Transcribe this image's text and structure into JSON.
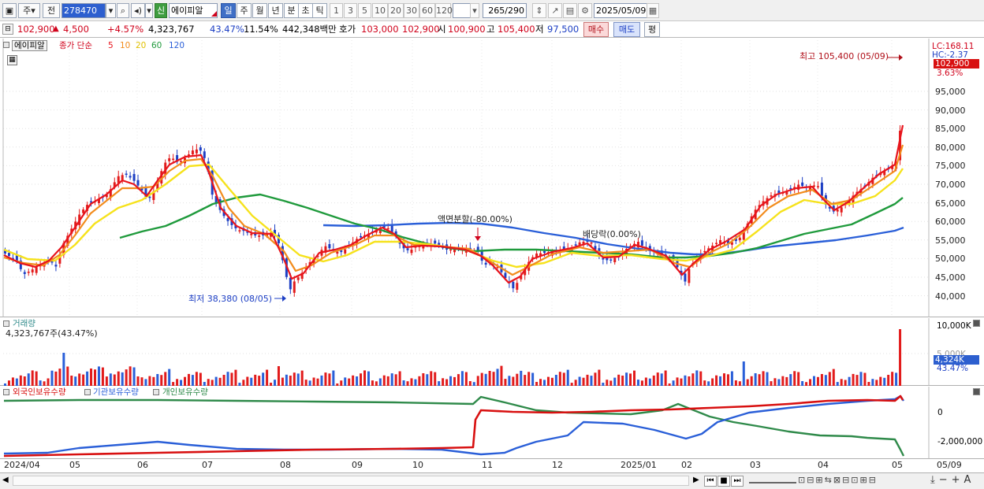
{
  "toolbar": {
    "period_types": [
      "주",
      "전"
    ],
    "code": "278470",
    "badge": "신",
    "stock_name": "에이피알",
    "periods": [
      "일",
      "주",
      "월",
      "년",
      "분",
      "초",
      "틱"
    ],
    "minutes": [
      "1",
      "3",
      "5",
      "10",
      "20",
      "30",
      "60",
      "120"
    ],
    "count": "265",
    "count_total": "/290",
    "date": "2025/05/09"
  },
  "quote": {
    "price": "102,900",
    "change": "4,500",
    "change_pct": "+4.57%",
    "volume": "4,323,767",
    "vol_ratio": "43.47%",
    "turnover": "11.54%",
    "amount": "442,348백만",
    "ask_label": "호가",
    "ask1": "103,000",
    "bid1": "102,900",
    "open_label": "시",
    "open": "100,900",
    "high_label": "고",
    "high": "105,400",
    "low_label": "저",
    "low": "97,500",
    "buy_label": "매수",
    "sell_label": "매도",
    "eval_label": "평"
  },
  "price_panel": {
    "legend_name": "에이피알",
    "legend_ma": "종가 단순",
    "ma_periods": [
      "5",
      "10",
      "20",
      "60",
      "120"
    ],
    "ma_colors": [
      "#e8141c",
      "#f28c1c",
      "#f6e21c",
      "#1f9a3c",
      "#2a5fd8"
    ],
    "lc": "LC:168.11",
    "hc": "HC:-2.37",
    "last_price": "102,900",
    "last_pct": "3.63%",
    "high_note": "최고 105,400 (05/09)",
    "low_note": "최저 38,380 (08/05)",
    "split_note": "액면분할(-80.00%)",
    "dividend_note": "배당락(0.00%)",
    "y_ticks": [
      "95,000",
      "90,000",
      "85,000",
      "80,000",
      "75,000",
      "70,000",
      "65,000",
      "60,000",
      "55,000",
      "50,000",
      "45,000",
      "40,000"
    ]
  },
  "volume_panel": {
    "title": "거래량",
    "value": "4,323,767주(43.47%)",
    "y_ticks": [
      "10,000K",
      "5,000K"
    ],
    "last": "4,324K",
    "last_pct": "43.47%"
  },
  "holder_panel": {
    "foreign": "외국인보유수량",
    "inst": "기관보유수량",
    "indiv": "개인보유수량",
    "colors": [
      "#d81010",
      "#2a5fd8",
      "#2f8a4a"
    ],
    "y_ticks": [
      "0",
      "-2,000,000"
    ]
  },
  "x_axis": [
    "2024/04",
    "05",
    "06",
    "07",
    "08",
    "09",
    "10",
    "11",
    "12",
    "2025/01",
    "02",
    "03",
    "04",
    "05",
    "05/09"
  ]
}
